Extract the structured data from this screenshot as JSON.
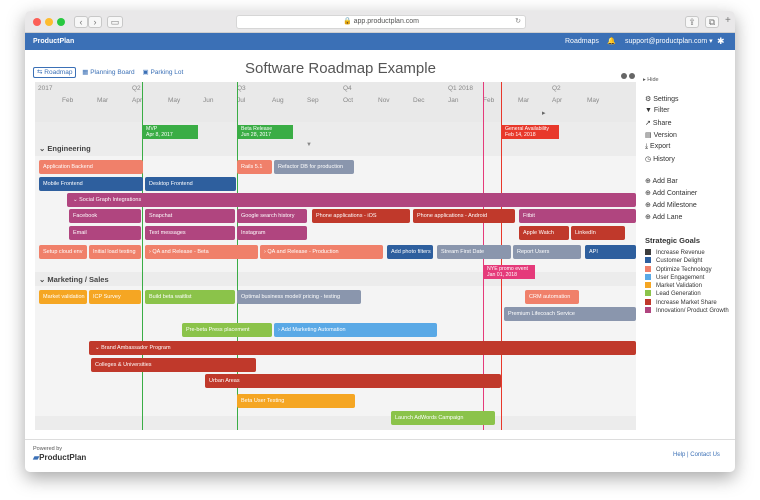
{
  "browser": {
    "url": "app.productplan.com"
  },
  "appbar": {
    "brand": "ProductPlan",
    "roadmaps": "Roadmaps",
    "user": "support@productplan.com"
  },
  "views": {
    "roadmap": "Roadmap",
    "planning": "Planning Board",
    "parking": "Parking Lot"
  },
  "title": "Software Roadmap Example",
  "hide": "Hide",
  "timeline": {
    "quarters": [
      "2017",
      "Q2",
      "Q3",
      "Q4",
      "Q1 2018",
      "Q2"
    ],
    "months": [
      "Feb",
      "Mar",
      "Apr",
      "May",
      "Jun",
      "Jul",
      "Aug",
      "Sep",
      "Oct",
      "Nov",
      "Dec",
      "Jan",
      "Feb",
      "Mar",
      "Apr",
      "May"
    ]
  },
  "milestones": [
    {
      "name": "MVP",
      "date": "Apr 8, 2017",
      "color": "#3aad45"
    },
    {
      "name": "Beta Release",
      "date": "Jun 28, 2017",
      "color": "#3aad45"
    },
    {
      "name": "General Availability",
      "date": "Feb 14, 2018",
      "color": "#e8382b"
    },
    {
      "name": "NYE promo event",
      "date": "Jan 01, 2018",
      "color": "#e53a7a"
    }
  ],
  "lanes": {
    "engineering": "Engineering",
    "marketing": "Marketing / Sales"
  },
  "bars": [
    "Application Backend",
    "Rails 5.1",
    "Refactor DB for production",
    "Mobile Frontend",
    "Desktop Frontend",
    "Social Graph Integrations",
    "Facebook",
    "Snapchat",
    "Google search history",
    "Phone applications - iOS",
    "Phone applications - Android",
    "Fitbit",
    "Email",
    "Text messages",
    "Instagram",
    "Apple Watch",
    "LinkedIn",
    "Setup cloud env",
    "Initial load testing",
    "QA and Release - Beta",
    "QA and Release - Production",
    "Add photo filters",
    "Stream First Date",
    "Report Users",
    "API",
    "Market validation",
    "ICP Survey",
    "Build beta waitlist",
    "Optimal business model/ pricing - testing",
    "CRM automation",
    "Premium Lifecoach Service",
    "Pre-beta Press placement",
    "Add Marketing Automation",
    "Brand Ambassador Program",
    "Colleges & Universities",
    "Urban Areas",
    "Beta User Testing",
    "Launch AdWords Campaign"
  ],
  "sidebar": {
    "actions": [
      "Settings",
      "Filter",
      "Share",
      "Version",
      "Export",
      "History"
    ],
    "adds": [
      "Add Bar",
      "Add Container",
      "Add Milestone",
      "Add Lane"
    ],
    "goals_title": "Strategic Goals",
    "goals": [
      {
        "label": "Increase Revenue",
        "color": "#3d3d3d"
      },
      {
        "label": "Customer Delight",
        "color": "#2e5f9e"
      },
      {
        "label": "Optimize Technology",
        "color": "#f0806a"
      },
      {
        "label": "User Engagement",
        "color": "#5aa9e6"
      },
      {
        "label": "Market Validation",
        "color": "#f5a623"
      },
      {
        "label": "Lead Generation",
        "color": "#8bc34a"
      },
      {
        "label": "Increase Market Share",
        "color": "#c0392b"
      },
      {
        "label": "Innovation/ Product Growth",
        "color": "#b0457f"
      }
    ]
  },
  "footer": {
    "powered": "Powered by",
    "brand": "ProductPlan",
    "links": "Help | Contact Us"
  }
}
